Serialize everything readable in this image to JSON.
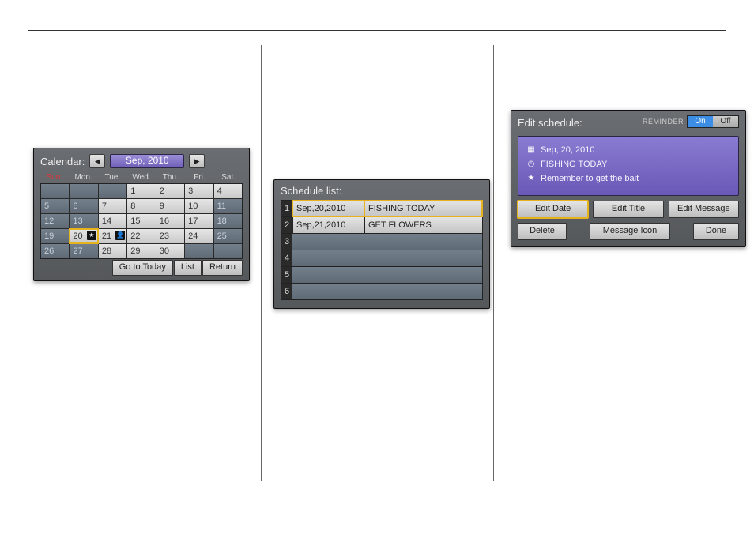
{
  "calendar": {
    "title": "Calendar:",
    "month_label": "Sep, 2010",
    "dow": [
      "Sun.",
      "Mon.",
      "Tue.",
      "Wed.",
      "Thu.",
      "Fri.",
      "Sat."
    ],
    "weeks": [
      [
        {
          "v": null
        },
        {
          "v": null
        },
        {
          "v": null
        },
        {
          "v": "1",
          "style": "light"
        },
        {
          "v": "2",
          "style": "light"
        },
        {
          "v": "3",
          "style": "light"
        },
        {
          "v": "4",
          "style": "light"
        }
      ],
      [
        {
          "v": "5",
          "style": "dark"
        },
        {
          "v": "6",
          "style": "dark"
        },
        {
          "v": "7",
          "style": "light"
        },
        {
          "v": "8",
          "style": "light"
        },
        {
          "v": "9",
          "style": "light"
        },
        {
          "v": "10",
          "style": "light"
        },
        {
          "v": "11",
          "style": "dark"
        }
      ],
      [
        {
          "v": "12",
          "style": "dark"
        },
        {
          "v": "13",
          "style": "dark"
        },
        {
          "v": "14",
          "style": "light"
        },
        {
          "v": "15",
          "style": "light"
        },
        {
          "v": "16",
          "style": "light"
        },
        {
          "v": "17",
          "style": "light"
        },
        {
          "v": "18",
          "style": "dark"
        }
      ],
      [
        {
          "v": "19",
          "style": "dark"
        },
        {
          "v": "20",
          "style": "light",
          "selected": true,
          "mark": "star"
        },
        {
          "v": "21",
          "style": "light",
          "mark": "person"
        },
        {
          "v": "22",
          "style": "light"
        },
        {
          "v": "23",
          "style": "light"
        },
        {
          "v": "24",
          "style": "light"
        },
        {
          "v": "25",
          "style": "dark"
        }
      ],
      [
        {
          "v": "26",
          "style": "dark"
        },
        {
          "v": "27",
          "style": "dark"
        },
        {
          "v": "28",
          "style": "light"
        },
        {
          "v": "29",
          "style": "light"
        },
        {
          "v": "30",
          "style": "light"
        },
        {
          "v": null
        },
        {
          "v": null
        }
      ]
    ],
    "footer": {
      "go_today": "Go to Today",
      "list": "List",
      "return": "Return"
    }
  },
  "schedule": {
    "title": "Schedule list:",
    "rows": [
      {
        "idx": "1",
        "date": "Sep,20,2010",
        "title": "FISHING TODAY",
        "selected": true
      },
      {
        "idx": "2",
        "date": "Sep,21,2010",
        "title": "GET FLOWERS"
      },
      {
        "idx": "3"
      },
      {
        "idx": "4"
      },
      {
        "idx": "5"
      },
      {
        "idx": "6"
      }
    ]
  },
  "edit": {
    "title": "Edit schedule:",
    "reminder_label": "REMINDER",
    "reminder_on": "On",
    "reminder_off": "Off",
    "reminder_state": "on",
    "lines": {
      "date": "Sep, 20, 2010",
      "subject": "FISHING TODAY",
      "message": "Remember to get the bait"
    },
    "buttons": {
      "edit_date": "Edit Date",
      "edit_title": "Edit Title",
      "edit_message": "Edit Message",
      "delete": "Delete",
      "message_icon": "Message Icon",
      "done": "Done"
    }
  }
}
